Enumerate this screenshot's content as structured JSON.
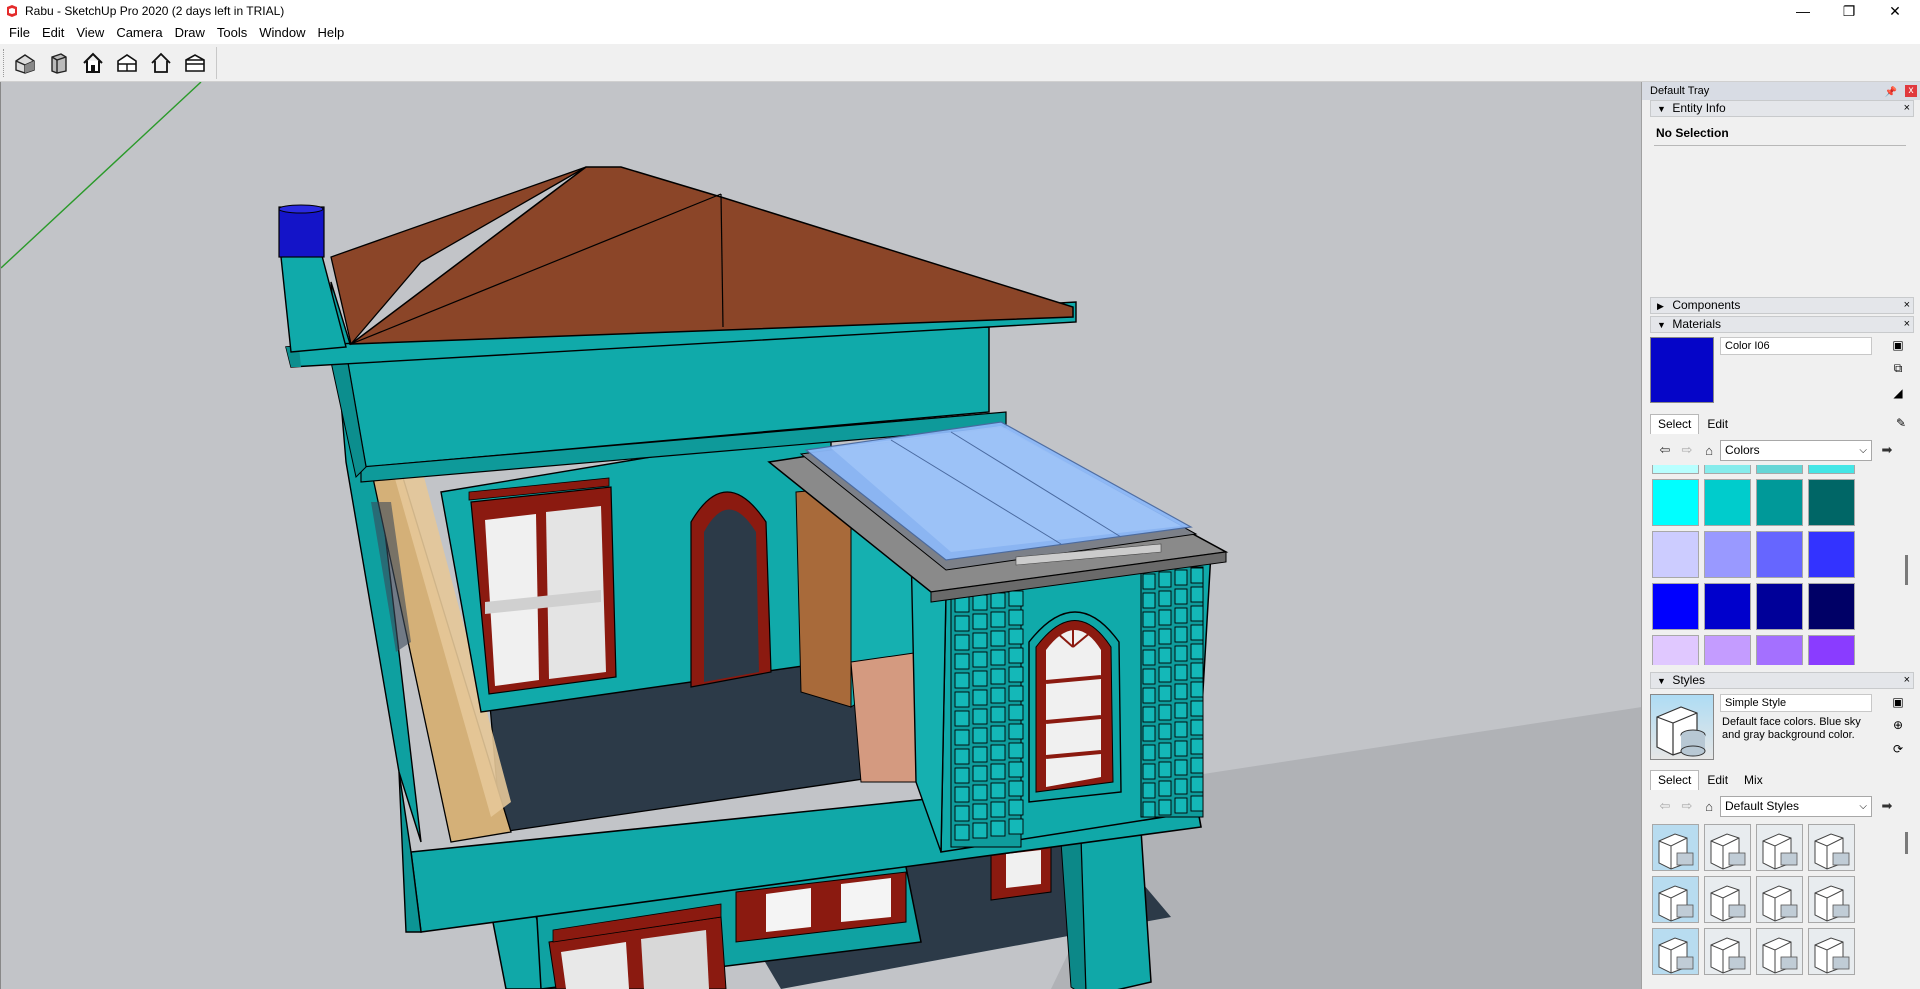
{
  "window": {
    "title": "Rabu - SketchUp Pro 2020 (2 days left in TRIAL)",
    "minimize_glyph": "—",
    "maximize_glyph": "❐",
    "close_glyph": "✕"
  },
  "menu": [
    "File",
    "Edit",
    "View",
    "Camera",
    "Draw",
    "Tools",
    "Window",
    "Help"
  ],
  "toolbar": {
    "icons": [
      "iso-view-icon",
      "front-view-icon",
      "top-view-icon",
      "right-view-icon",
      "back-view-icon",
      "left-view-icon"
    ]
  },
  "tray": {
    "title": "Default Tray",
    "pin_glyph": "📌",
    "close_glyph": "x",
    "entity_info": {
      "header": "Entity Info",
      "selection": "No Selection"
    },
    "components": {
      "header": "Components"
    },
    "materials": {
      "header": "Materials",
      "material_name": "Color I06",
      "current_color": "#0505c8",
      "tabs": [
        "Select",
        "Edit"
      ],
      "library": "Colors",
      "swatch_rows": [
        [
          "#b8ffff",
          "#86ecec",
          "#66d6d6",
          "#44e6e6"
        ],
        [
          "#00ffff",
          "#00cccc",
          "#009999",
          "#006666"
        ],
        [
          "#ccccff",
          "#9999ff",
          "#6666ff",
          "#3333ff"
        ],
        [
          "#0000ff",
          "#0000cc",
          "#000099",
          "#000066"
        ],
        [
          "#e0c8ff",
          "#c49cff",
          "#a470ff",
          "#8a3cff"
        ]
      ]
    },
    "styles": {
      "header": "Styles",
      "style_name": "Simple Style",
      "description": "Default face colors. Blue sky and gray background color.",
      "tabs": [
        "Select",
        "Edit",
        "Mix"
      ],
      "library": "Default Styles",
      "thumbs": 12
    }
  },
  "scene": {
    "accent_teal": "#10a8a8",
    "roof": "#8b4528",
    "chimney_top": "#1414c8",
    "glass_roof": "#8cb8f8",
    "floor": "#2c3a48",
    "door_frame": "#8b1a10"
  }
}
